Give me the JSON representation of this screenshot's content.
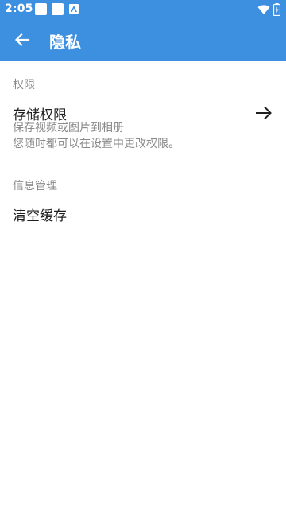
{
  "status_bar": {
    "time": "2:05",
    "notification_icons": [
      "notification-icon",
      "notification-icon",
      "android-icon"
    ],
    "wifi_icon": "wifi-icon",
    "battery_icon": "battery-charging-icon"
  },
  "app_bar": {
    "back_icon": "arrow-left-icon",
    "title": "隐私"
  },
  "sections": [
    {
      "header": "权限",
      "items": [
        {
          "title": "存储权限",
          "summary_line1": "保存视频或图片到相册",
          "summary_line2": "您随时都可以在设置中更改权限。",
          "trailing_icon": "arrow-right-icon"
        }
      ]
    },
    {
      "header": "信息管理",
      "items": [
        {
          "title": "清空缓存"
        }
      ]
    }
  ],
  "colors": {
    "primary": "#3d8fe0",
    "text_primary": "#202020",
    "text_secondary": "#8a8a8a",
    "background": "#ffffff"
  }
}
